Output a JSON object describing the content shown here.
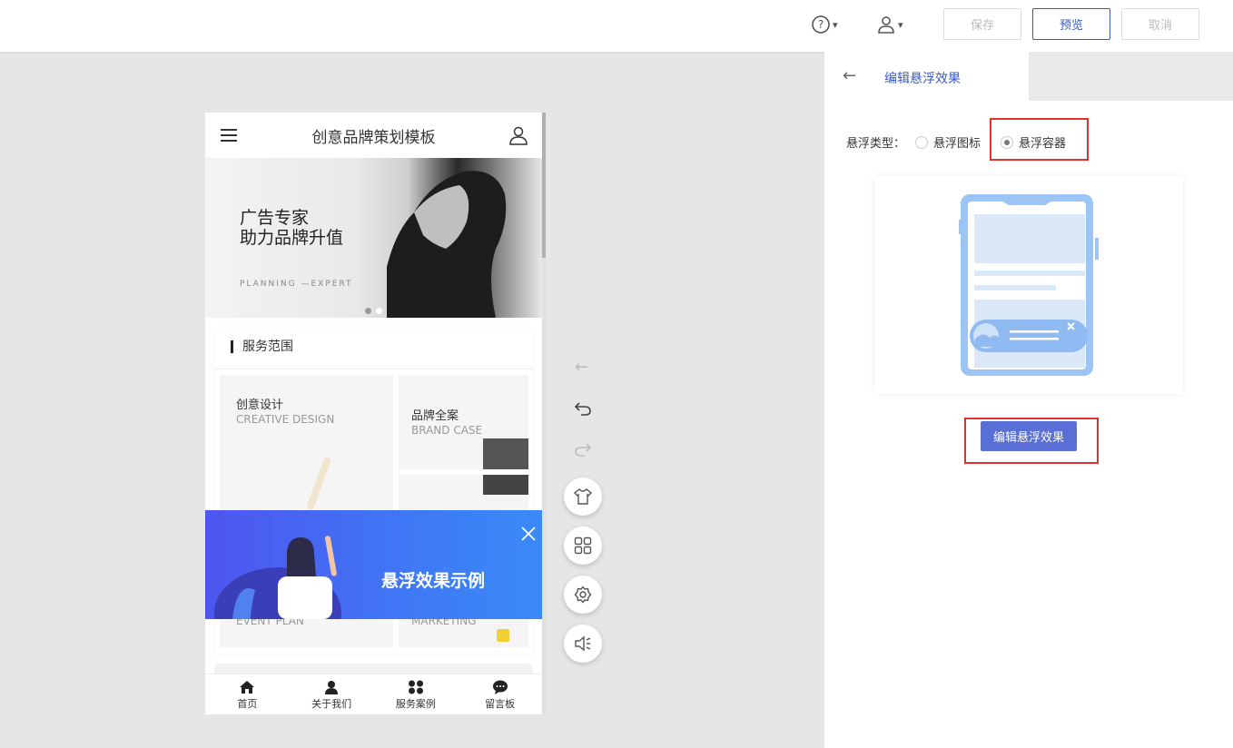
{
  "topbar": {
    "help_icon": "help-circle-icon",
    "user_icon": "user-icon",
    "save_label": "保存",
    "preview_label": "预览",
    "cancel_label": "取消"
  },
  "phone": {
    "title": "创意品牌策划模板",
    "banner": {
      "line1": "广告专家",
      "line2": "助力品牌升值",
      "tagline": "PLANNING —EXPERT"
    },
    "services": {
      "title": "服务范围",
      "tiles": [
        {
          "title": "创意设计",
          "subtitle": "CREATIVE DESIGN"
        },
        {
          "title": "品牌全案",
          "subtitle": "BRAND CASE"
        },
        {
          "title": "EVENT PLAN"
        },
        {
          "title": "MARKETING"
        }
      ]
    },
    "float": {
      "text": "悬浮效果示例"
    },
    "nav": [
      {
        "label": "首页",
        "icon": "home-icon"
      },
      {
        "label": "关于我们",
        "icon": "person-icon"
      },
      {
        "label": "服务案例",
        "icon": "grid-icon"
      },
      {
        "label": "留言板",
        "icon": "chat-icon"
      }
    ]
  },
  "panel": {
    "title": "编辑悬浮效果",
    "type_label": "悬浮类型：",
    "option_icon": "悬浮图标",
    "option_container": "悬浮容器",
    "selected": "悬浮容器",
    "edit_button": "编辑悬浮效果"
  },
  "colors": {
    "accent": "#3b59c6",
    "edit_button": "#5a6fd6",
    "highlight": "#e03131",
    "float_banner": "#4f55f0"
  }
}
